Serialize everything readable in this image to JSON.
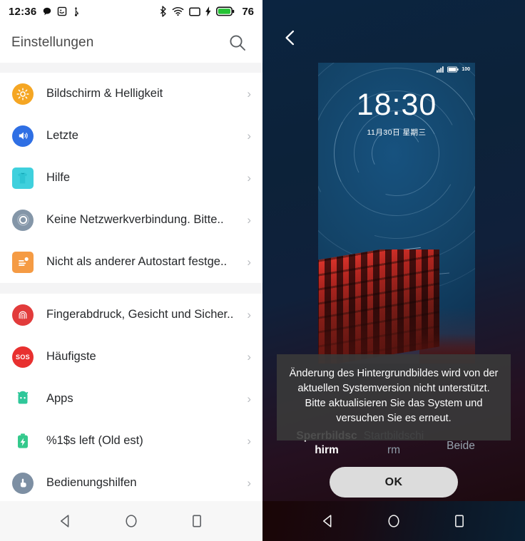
{
  "left": {
    "statusbar": {
      "time": "12:36",
      "battery_level": "76",
      "icons": [
        "chat-bubble-icon",
        "smiley-box-icon",
        "usb-icon",
        "bluetooth-icon",
        "wifi-icon",
        "screen-cast-icon",
        "charging-bolt-icon",
        "battery-icon"
      ]
    },
    "header": {
      "title": "Einstellungen",
      "search_icon": "search-icon"
    },
    "groups": [
      {
        "items": [
          {
            "label": "Bildschirm & Helligkeit",
            "icon": "brightness-icon",
            "color": "#f5a623",
            "shape": "circle"
          },
          {
            "label": "Letzte",
            "icon": "sound-icon",
            "color": "#2f6fe4",
            "shape": "circle"
          },
          {
            "label": "Hilfe",
            "icon": "shirt-icon",
            "color": "#3fd0dd",
            "shape": "square"
          },
          {
            "label": "Keine Netzwerkverbindung. Bitte..",
            "icon": "ring-icon",
            "color": "#8496a8",
            "shape": "circle"
          },
          {
            "label": "Nicht als anderer Autostart festge..",
            "icon": "document-icon",
            "color": "#f59b44",
            "shape": "square"
          }
        ]
      },
      {
        "items": [
          {
            "label": "Fingerabdruck, Gesicht und Sicher..",
            "icon": "fingerprint-icon",
            "color": "#e23b3b",
            "shape": "circle"
          },
          {
            "label": "Häufigste",
            "icon": "sos-icon",
            "color": "#e8302f",
            "shape": "circle"
          },
          {
            "label": "Apps",
            "icon": "android-robot-icon",
            "color": "#2fc79a",
            "shape": "square"
          },
          {
            "label": "%1$s left (Old est)",
            "icon": "battery-bolt-icon",
            "color": "#34c98c",
            "shape": "square"
          },
          {
            "label": "Bedienungshilfen",
            "icon": "hand-pointer-icon",
            "color": "#7d8fa3",
            "shape": "circle"
          }
        ]
      }
    ],
    "chevron": "›",
    "navbar": {
      "back": "back-nav-icon",
      "home": "home-nav-icon",
      "recents": "recents-nav-icon"
    }
  },
  "right": {
    "back_icon": "back-chevron-icon",
    "preview": {
      "status_signal": "signal-bars-icon",
      "status_battery": "battery-icon",
      "status_battery_level": "100",
      "time": "18:30",
      "date": "11月30日 星期三"
    },
    "dialog": {
      "message": "Änderung des Hintergrundbildes wird von der aktuellen Systemversion nicht unterstützt. Bitte aktualisieren Sie das System und versuchen Sie es erneut."
    },
    "tabs": [
      {
        "label": "Sperrbildschirm",
        "state": "active"
      },
      {
        "label": "Startbildschirm",
        "state": "inactive"
      },
      {
        "label": "Beide",
        "state": "inactive"
      }
    ],
    "ok_button": "OK",
    "navbar": {
      "back": "back-nav-icon",
      "home": "home-nav-icon",
      "recents": "recents-nav-icon"
    }
  }
}
